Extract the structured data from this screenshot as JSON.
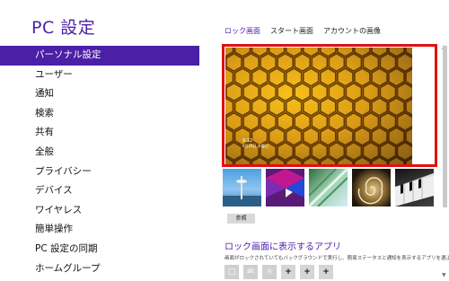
{
  "app": {
    "title": "PC 設定"
  },
  "nav": {
    "items": [
      {
        "label": "パーソナル設定",
        "active": true
      },
      {
        "label": "ユーザー"
      },
      {
        "label": "通知"
      },
      {
        "label": "検索"
      },
      {
        "label": "共有"
      },
      {
        "label": "全般"
      },
      {
        "label": "プライバシー"
      },
      {
        "label": "デバイス"
      },
      {
        "label": "ワイヤレス"
      },
      {
        "label": "簡単操作"
      },
      {
        "label": "PC 設定の同期"
      },
      {
        "label": "ホームグループ"
      }
    ]
  },
  "tabs": [
    {
      "label": "ロック画面",
      "active": true
    },
    {
      "label": "スタート画面"
    },
    {
      "label": "アカウントの画像"
    }
  ],
  "preview": {
    "time": "8:12",
    "date": "9月26日 木曜日"
  },
  "thumbnails": [
    {
      "icon": "space-needle-image"
    },
    {
      "icon": "geometric-image"
    },
    {
      "icon": "escalator-image"
    },
    {
      "icon": "nautilus-shell-image"
    },
    {
      "icon": "piano-keys-image"
    }
  ],
  "browse_label": "参照",
  "lock_apps": {
    "title": "ロック画面に表示するアプリ",
    "description": "画面がロックされていてもバックグラウンドで実行し、簡易ステータスと通知を表示するアプリを選ぶ",
    "slots": [
      "□",
      "✉",
      "☼",
      "+",
      "+",
      "+"
    ]
  },
  "colors": {
    "accent": "#4b1fa6",
    "highlight_border": "#e01010"
  }
}
